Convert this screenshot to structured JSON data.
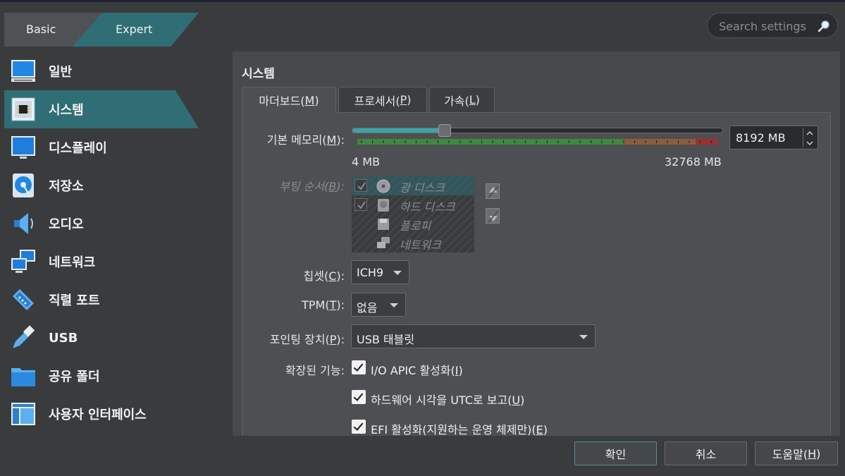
{
  "mode_tabs": {
    "basic": "Basic",
    "expert": "Expert"
  },
  "search": {
    "placeholder": "Search settings"
  },
  "sidebar": {
    "items": [
      {
        "label": "일반",
        "icon": "monitor-icon"
      },
      {
        "label": "시스템",
        "icon": "chip-icon"
      },
      {
        "label": "디스플레이",
        "icon": "display-icon"
      },
      {
        "label": "저장소",
        "icon": "disk-icon"
      },
      {
        "label": "오디오",
        "icon": "speaker-icon"
      },
      {
        "label": "네트워크",
        "icon": "network-icon"
      },
      {
        "label": "직렬 포트",
        "icon": "serial-icon"
      },
      {
        "label": "USB",
        "icon": "usb-icon"
      },
      {
        "label": "공유 폴더",
        "icon": "folder-icon"
      },
      {
        "label": "사용자 인터페이스",
        "icon": "ui-icon"
      }
    ]
  },
  "panel": {
    "title": "시스템",
    "tabs": [
      {
        "text": "마더보드(",
        "key": "M",
        "end": ")"
      },
      {
        "text": "프로세서(",
        "key": "P",
        "end": ")"
      },
      {
        "text": "가속(",
        "key": "L",
        "end": ")"
      }
    ]
  },
  "memory": {
    "label": "기본 메모리(",
    "key": "M",
    "label_end": "):",
    "value": "8192 MB",
    "min": "4 MB",
    "max": "32768 MB",
    "fraction": 0.25
  },
  "boot": {
    "label": "부팅 순서(",
    "key": "B",
    "label_end": "):",
    "items": [
      "광 디스크",
      "하드 디스크",
      "플로피",
      "네트워크"
    ]
  },
  "chipset": {
    "label": "칩셋(",
    "key": "C",
    "label_end": "):",
    "value": "ICH9"
  },
  "tpm": {
    "label": "TPM(",
    "key": "T",
    "label_end": "):",
    "value": "없음"
  },
  "pointing": {
    "label": "포인팅 장치(",
    "key": "P",
    "label_end": "):",
    "value": "USB 태블릿"
  },
  "extended": {
    "label": "확장된 기능:",
    "options": [
      {
        "text": "I/O APIC 활성화(",
        "key": "I",
        "end": ")"
      },
      {
        "text": "하드웨어 시각을 UTC로 보고(",
        "key": "U",
        "end": ")"
      },
      {
        "text": "EFI 활성화(지원하는 운영 체제만)(",
        "key": "E",
        "end": ")"
      }
    ]
  },
  "buttons": {
    "ok": "확인",
    "cancel": "취소",
    "help_text": "도움말(",
    "help_key": "H",
    "help_end": ")"
  },
  "colors": {
    "accent": "#2e6e74",
    "panel": "#48494b",
    "background": "#3a3b3d"
  }
}
